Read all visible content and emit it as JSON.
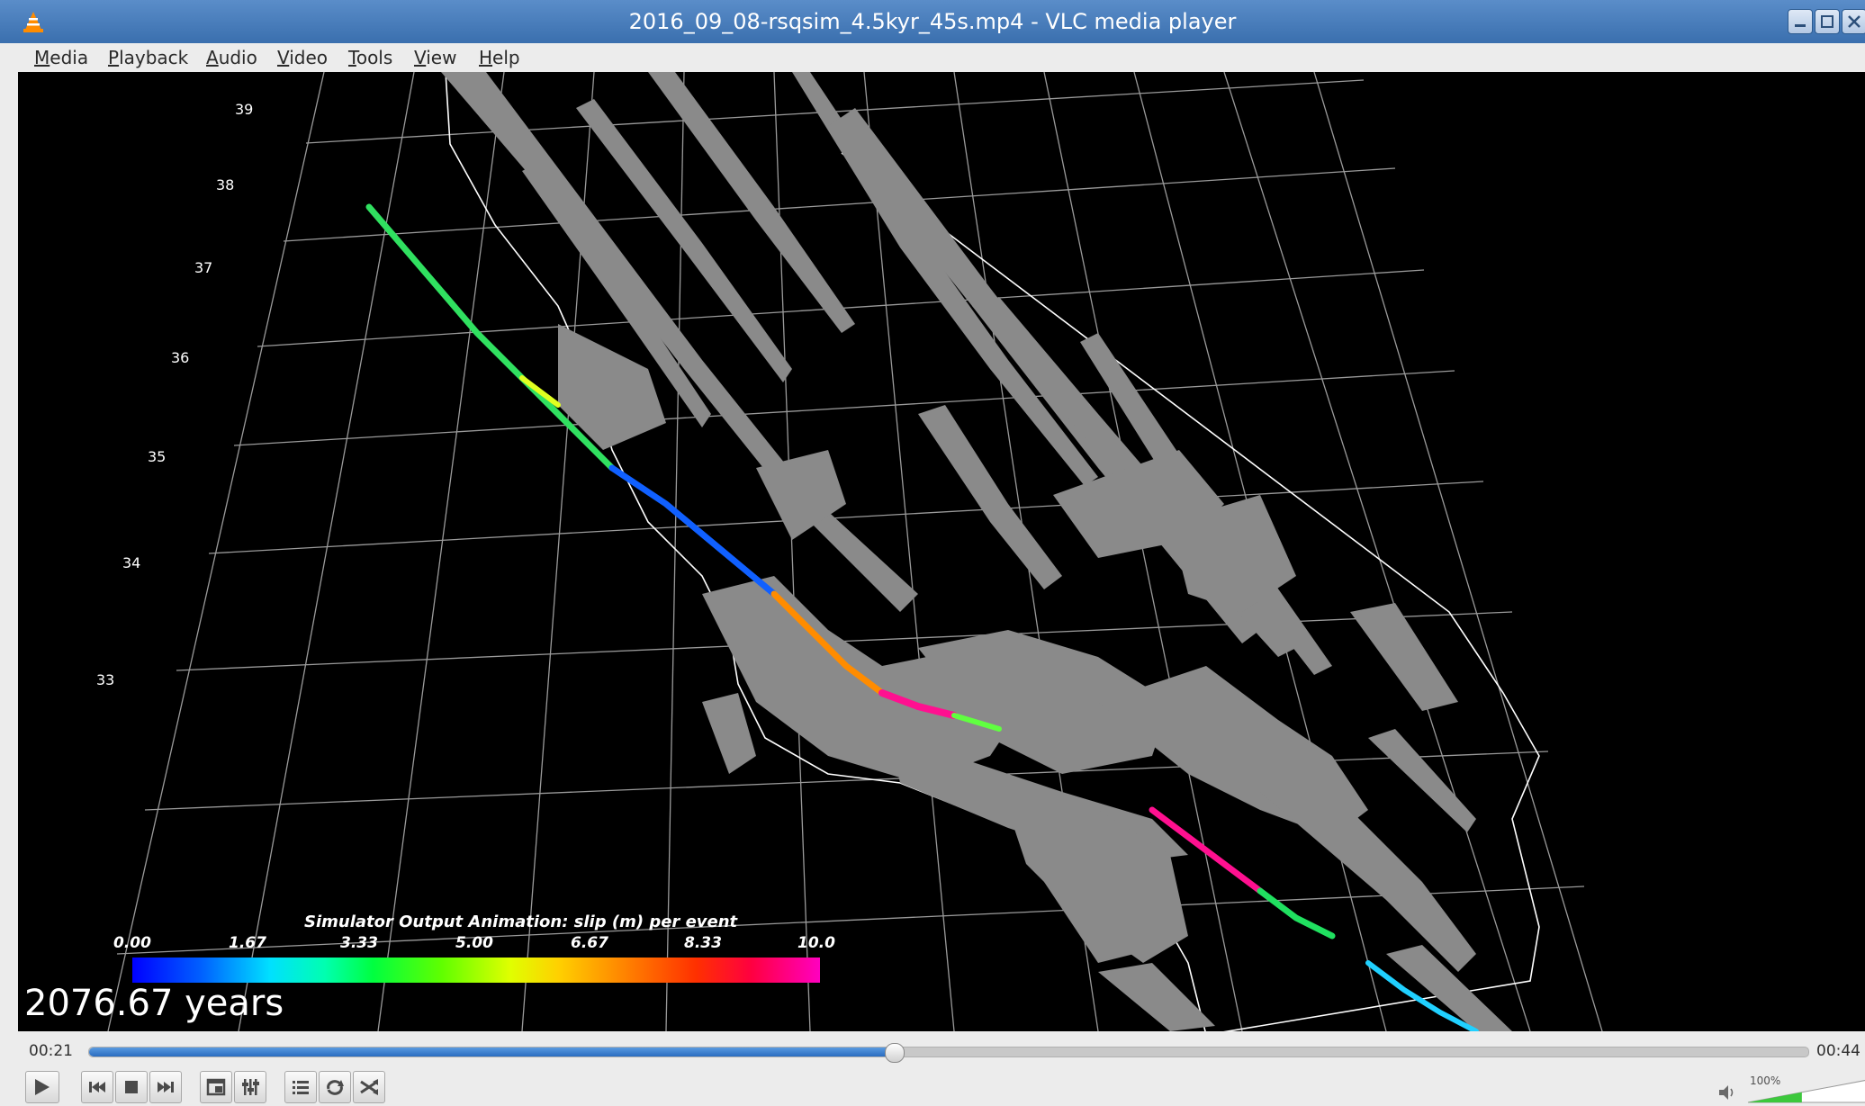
{
  "window": {
    "title": "2016_09_08-rsqsim_4.5kyr_45s.mp4 - VLC media player",
    "app_icon": "vlc-cone-icon",
    "controls": [
      "minimize-icon",
      "maximize-icon",
      "close-icon"
    ]
  },
  "menubar": {
    "items": [
      {
        "label": "Media",
        "mnemonic": "M",
        "rest": "edia"
      },
      {
        "label": "Playback",
        "mnemonic": "P",
        "rest": "layback"
      },
      {
        "label": "Audio",
        "mnemonic": "A",
        "rest": "udio"
      },
      {
        "label": "Video",
        "mnemonic": "V",
        "rest": "ideo"
      },
      {
        "label": "Tools",
        "mnemonic": "T",
        "rest": "ools"
      },
      {
        "label": "View",
        "mnemonic": "V",
        "rest": "iew"
      },
      {
        "label": "Help",
        "mnemonic": "H",
        "rest": "elp"
      }
    ]
  },
  "video": {
    "colorbar_title": "Simulator Output Animation: slip (m) per event",
    "colorbar_ticks": [
      "0.00",
      "1.67",
      "3.33",
      "5.00",
      "6.67",
      "8.33",
      "10.0"
    ],
    "time_overlay": "2076.67 years",
    "latitude_labels": [
      "39",
      "38",
      "37",
      "36",
      "35",
      "34",
      "33"
    ]
  },
  "playback": {
    "elapsed": "00:21",
    "total": "00:44",
    "progress_fraction": 0.468
  },
  "toolbar": {
    "buttons": [
      "play-icon",
      "previous-icon",
      "stop-icon",
      "next-icon",
      "fullscreen-icon",
      "extended-settings-icon",
      "playlist-icon",
      "loop-icon",
      "shuffle-icon"
    ]
  },
  "volume": {
    "label": "100%",
    "level_fraction": 1.0
  },
  "colors": {
    "titlebar": "#4a7fbf",
    "chrome": "#ececec",
    "seek_fill": "#3a7fd0",
    "fault_gray": "#8a8a8a"
  }
}
